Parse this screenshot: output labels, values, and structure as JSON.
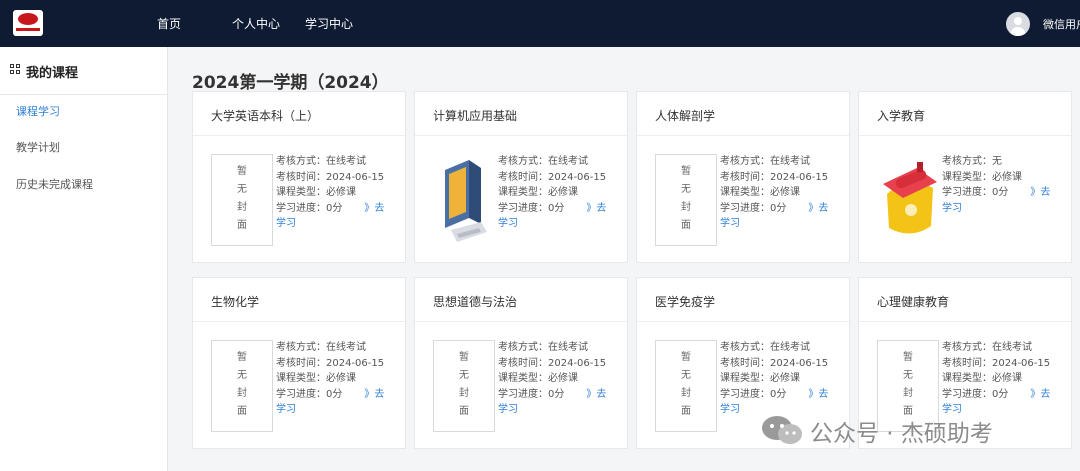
{
  "header": {
    "nav": [
      "首页",
      "个人中心",
      "学习中心"
    ],
    "username": "微信用户"
  },
  "sidebar": {
    "title": "我的课程",
    "items": [
      {
        "label": "课程学习",
        "active": true
      },
      {
        "label": "教学计划",
        "active": false
      },
      {
        "label": "历史未完成课程",
        "active": false
      }
    ]
  },
  "main": {
    "term_title": "2024第一学期（2024）",
    "no_cover": [
      "暂",
      "无",
      "封",
      "面"
    ],
    "go_label_a": "》去",
    "go_label_b": "学习",
    "courses": [
      {
        "title": "大学英语本科（上）",
        "cover": "none",
        "lines": [
          "考核方式：在线考试",
          "考核时间：2024-06-15",
          "课程类型：必修课"
        ],
        "progress": "学习进度：0分"
      },
      {
        "title": "计算机应用基础",
        "cover": "computer-image",
        "lines": [
          "考核方式：在线考试",
          "考核时间：2024-06-15",
          "课程类型：必修课"
        ],
        "progress": "学习进度：0分"
      },
      {
        "title": "人体解剖学",
        "cover": "none",
        "lines": [
          "考核方式：在线考试",
          "考核时间：2024-06-15",
          "课程类型：必修课"
        ],
        "progress": "学习进度：0分"
      },
      {
        "title": "入学教育",
        "cover": "graduation-image",
        "lines": [
          "考核方式：无",
          "课程类型：必修课"
        ],
        "progress": "学习进度：0分"
      },
      {
        "title": "生物化学",
        "cover": "none",
        "lines": [
          "考核方式：在线考试",
          "考核时间：2024-06-15",
          "课程类型：必修课"
        ],
        "progress": "学习进度：0分"
      },
      {
        "title": "思想道德与法治",
        "cover": "none",
        "lines": [
          "考核方式：在线考试",
          "考核时间：2024-06-15",
          "课程类型：必修课"
        ],
        "progress": "学习进度：0分"
      },
      {
        "title": "医学免疫学",
        "cover": "none",
        "lines": [
          "考核方式：在线考试",
          "考核时间：2024-06-15",
          "课程类型：必修课"
        ],
        "progress": "学习进度：0分"
      },
      {
        "title": "心理健康教育",
        "cover": "none",
        "lines": [
          "考核方式：在线考试",
          "考核时间：2024-06-15",
          "课程类型：必修课"
        ],
        "progress": "学习进度：0分"
      }
    ]
  },
  "watermark": {
    "text": "公众号 · 杰硕助考"
  },
  "colors": {
    "header_bg": "#0f1b33",
    "accent": "#2f7fd8",
    "brand_red": "#c8161d"
  }
}
